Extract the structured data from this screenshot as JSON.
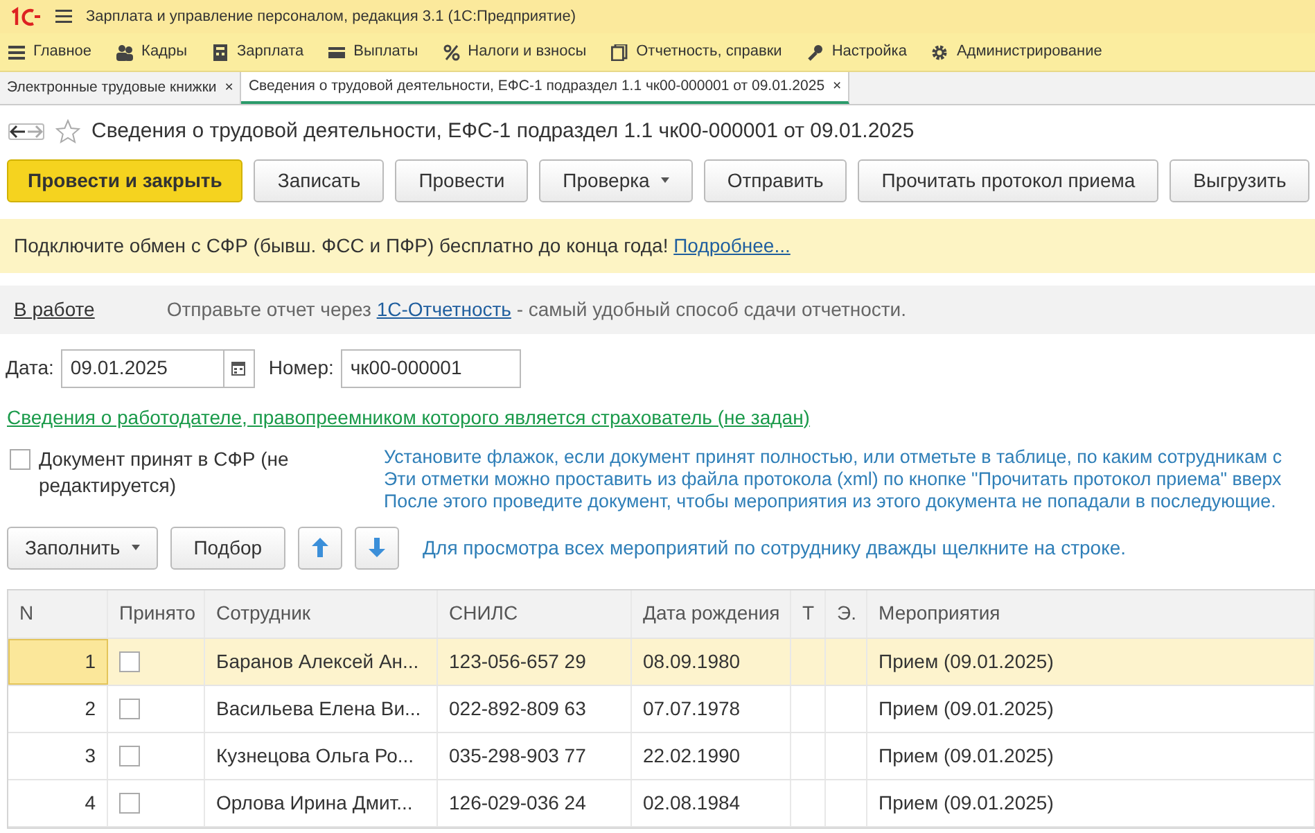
{
  "window": {
    "title": "Зарплата и управление персоналом, редакция 3.1  (1С:Предприятие)"
  },
  "menu": [
    {
      "label": "Главное"
    },
    {
      "label": "Кадры"
    },
    {
      "label": "Зарплата"
    },
    {
      "label": "Выплаты"
    },
    {
      "label": "Налоги и взносы"
    },
    {
      "label": "Отчетность, справки"
    },
    {
      "label": "Настройка"
    },
    {
      "label": "Администрирование"
    }
  ],
  "tabs": [
    {
      "label": "Электронные трудовые книжки",
      "selected": false,
      "close": "×"
    },
    {
      "label": "Сведения о трудовой деятельности, ЕФС-1 подраздел 1.1 чк00-000001 от 09.01.2025",
      "selected": true,
      "close": "×"
    }
  ],
  "document": {
    "title": "Сведения о трудовой деятельности, ЕФС-1 подраздел 1.1 чк00-000001 от 09.01.2025",
    "favorite": false
  },
  "buttons": [
    {
      "label": "Провести и закрыть",
      "primary": true,
      "dropdown": false
    },
    {
      "label": "Записать",
      "primary": false,
      "dropdown": false
    },
    {
      "label": "Провести",
      "primary": false,
      "dropdown": false
    },
    {
      "label": "Проверка",
      "primary": false,
      "dropdown": true
    },
    {
      "label": "Отправить",
      "primary": false,
      "dropdown": false
    },
    {
      "label": "Прочитать протокол приема",
      "primary": false,
      "dropdown": false
    },
    {
      "label": "Выгрузить",
      "primary": false,
      "dropdown": false
    }
  ],
  "banner": {
    "text": "Подключите обмен с СФР (бывш. ФСС и ПФР) бесплатно до конца года!",
    "link": "Подробнее..."
  },
  "status": {
    "label": "В работе",
    "before": "Отправьте отчет через",
    "link": "1С-Отчетность",
    "after": "- самый удобный способ сдачи отчетности."
  },
  "date": {
    "label": "Дата:",
    "value": "09.01.2025"
  },
  "number": {
    "label": "Номер:",
    "value": "чк00-000001"
  },
  "employer_link": "Сведения о работодателе, правопреемником которого является страхователь (не задан)",
  "accepted": {
    "label": "Документ принят в СФР (не редактируется)",
    "checked": false
  },
  "hint_lines": [
    "Установите флажок, если документ принят полностью, или отметьте в таблице, по каким сотрудникам с",
    "Эти отметки можно проставить из файла протокола (xml) по кнопке \"Прочитать протокол приема\" вверх",
    "После этого проведите документ, чтобы мероприятия из этого документа не попадали в последующие."
  ],
  "toolbar": {
    "fill": "Заполнить",
    "pick": "Подбор",
    "hint": "Для просмотра всех мероприятий по сотруднику дважды щелкните на строке."
  },
  "table": {
    "columns": [
      "N",
      "Принято",
      "Сотрудник",
      "СНИЛС",
      "Дата рождения",
      "Т",
      "Э.",
      "Мероприятия"
    ],
    "rows": [
      {
        "n": "1",
        "accepted": false,
        "employee": "Баранов Алексей Ан...",
        "snils": "123-056-657 29",
        "birth": "08.09.1980",
        "events": "Прием (09.01.2025)",
        "selected": true
      },
      {
        "n": "2",
        "accepted": false,
        "employee": "Васильева Елена Ви...",
        "snils": "022-892-809 63",
        "birth": "07.07.1978",
        "events": "Прием (09.01.2025)",
        "selected": false
      },
      {
        "n": "3",
        "accepted": false,
        "employee": "Кузнецова Ольга Ро...",
        "snils": "035-298-903 77",
        "birth": "22.02.1990",
        "events": "Прием (09.01.2025)",
        "selected": false
      },
      {
        "n": "4",
        "accepted": false,
        "employee": "Орлова Ирина Дмит...",
        "snils": "126-029-036 24",
        "birth": "02.08.1984",
        "events": "Прием (09.01.2025)",
        "selected": false
      }
    ]
  }
}
